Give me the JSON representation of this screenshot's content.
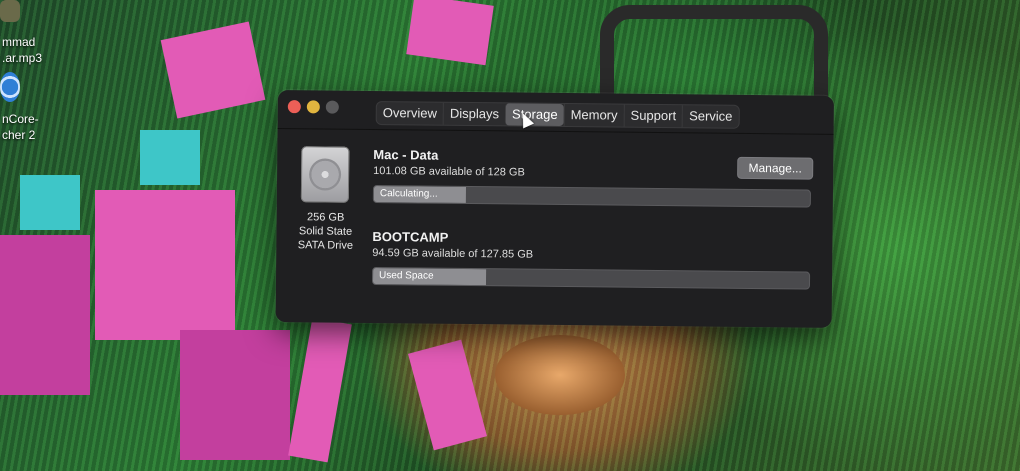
{
  "desktop": {
    "icon1_label_line1": "mmad",
    "icon1_label_line2": ".ar.mp3",
    "icon2_label_line1": "nCore-",
    "icon2_label_line2": "cher 2"
  },
  "window": {
    "tabs": [
      {
        "label": "Overview"
      },
      {
        "label": "Displays"
      },
      {
        "label": "Storage"
      },
      {
        "label": "Memory"
      },
      {
        "label": "Support"
      },
      {
        "label": "Service"
      }
    ],
    "active_tab": "Storage",
    "drive": {
      "capacity": "256 GB",
      "type_line1": "Solid State",
      "type_line2": "SATA Drive",
      "icon": "hard-drive-icon"
    },
    "volumes": [
      {
        "name": "Mac - Data",
        "available": "101.08 GB available of 128 GB",
        "bar_label": "Calculating...",
        "used_fraction": 0.21
      },
      {
        "name": "BOOTCAMP",
        "available": "94.59 GB available of 127.85 GB",
        "bar_label": "Used Space",
        "used_fraction": 0.26
      }
    ],
    "manage_label": "Manage..."
  },
  "colors": {
    "window_bg": "#1f1f21",
    "close": "#ec5f57",
    "minimize": "#e1b53f",
    "zoom_disabled": "#5a5a5c",
    "active_tab": "#5d5d60"
  }
}
